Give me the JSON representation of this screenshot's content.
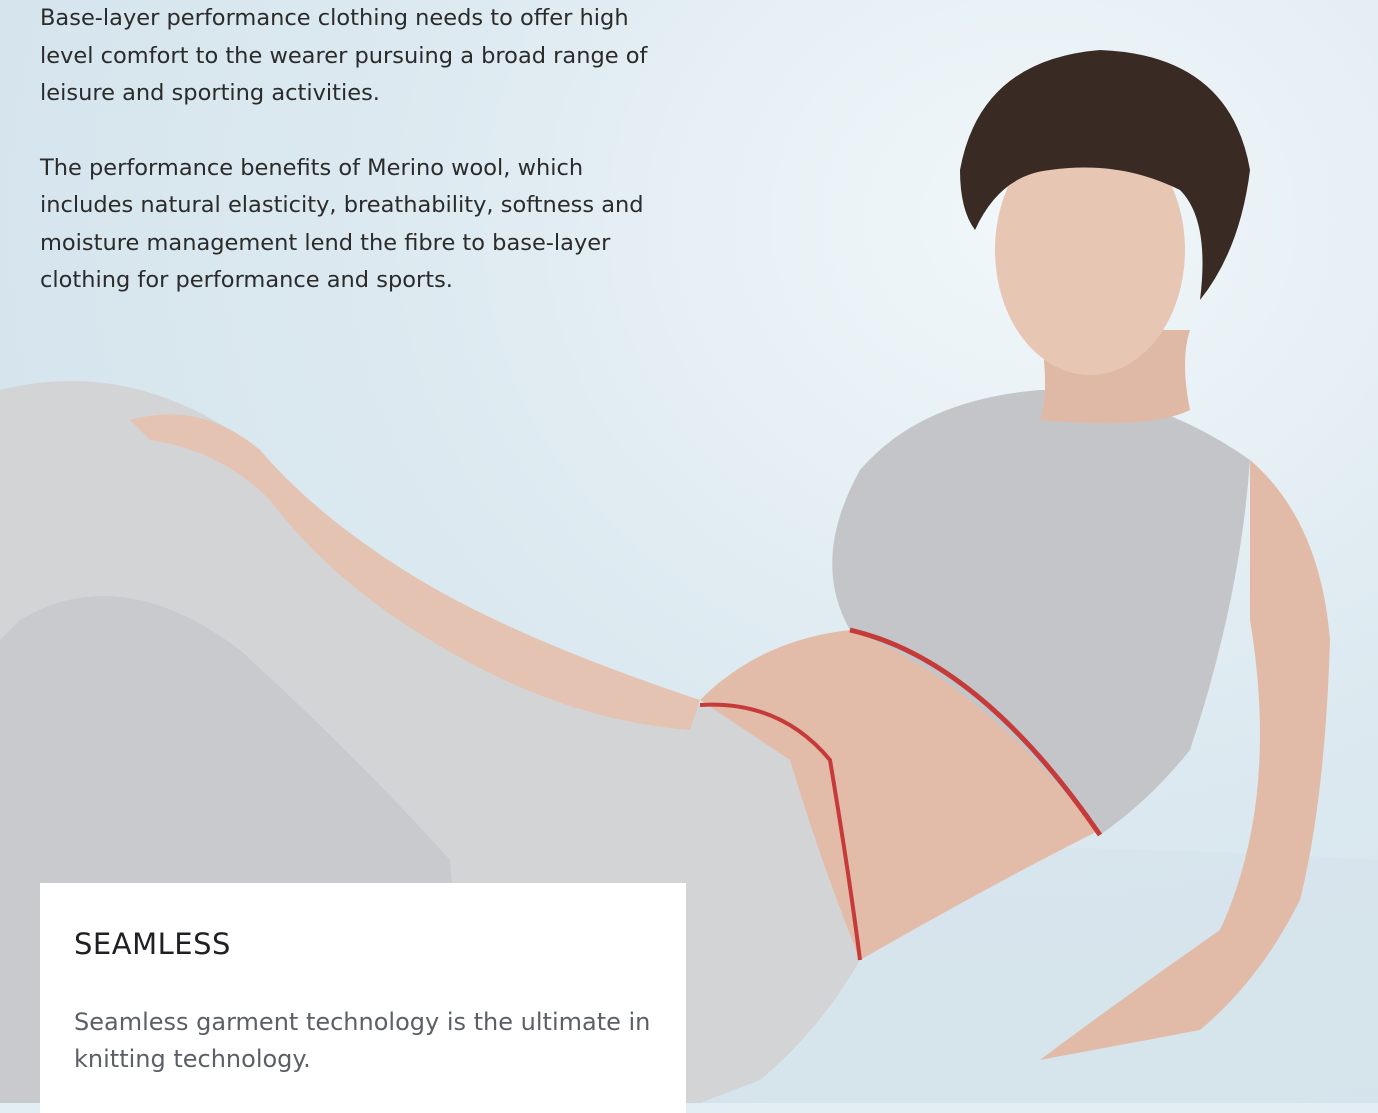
{
  "intro": {
    "paragraph_1": "Base-layer performance clothing needs to offer high level comfort to the wearer pursuing a broad range of leisure and sporting activities.",
    "paragraph_2": "The performance benefits of Merino wool, which includes natural elasticity, breathability, softness and moisture management lend the fibre to base-layer clothing for performance and sports."
  },
  "feature_card": {
    "title": "SEAMLESS",
    "description": "Seamless garment technology is the ultimate in knitting technology."
  },
  "colors": {
    "background": "#dce9f0",
    "garment": "#c8c9cb",
    "trim": "#c73a3a",
    "card": "#ffffff"
  }
}
